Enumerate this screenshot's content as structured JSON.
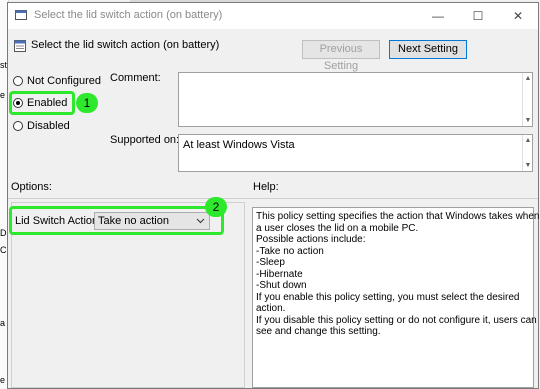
{
  "window": {
    "title": "Select the lid switch action (on battery)",
    "controls": {
      "minimize": "—",
      "maximize": "☐",
      "close": "✕"
    }
  },
  "header": {
    "policy_name": "Select the lid switch action (on battery)",
    "previous_label": "Previous Setting",
    "next_label": "Next Setting"
  },
  "state": {
    "options": [
      {
        "label": "Not Configured",
        "selected": false
      },
      {
        "label": "Enabled",
        "selected": true
      },
      {
        "label": "Disabled",
        "selected": false
      }
    ]
  },
  "comment": {
    "label": "Comment:",
    "value": ""
  },
  "supported": {
    "label": "Supported on:",
    "value": "At least Windows Vista"
  },
  "options_pane": {
    "label": "Options:",
    "field_label": "Lid Switch Action",
    "field_value": "Take no action"
  },
  "help": {
    "label": "Help:",
    "lines": [
      "This policy setting specifies the action that Windows takes when",
      "a user closes the lid on a mobile PC.",
      "",
      "Possible actions include:",
      "-Take no action",
      "-Sleep",
      "-Hibernate",
      "-Shut down",
      "",
      "If you enable this policy setting, you must select the desired",
      "action.",
      "",
      "If you disable this policy setting or do not configure it, users can",
      "see and change this setting."
    ]
  },
  "annotations": [
    {
      "label": "1"
    },
    {
      "label": "2"
    }
  ],
  "background_fragments": [
    "st",
    "e",
    "D",
    "C",
    "a",
    "e"
  ],
  "colors": {
    "highlight": "#2ee82e",
    "accent": "#0078d7"
  },
  "icons": {
    "title": "policy-icon",
    "header": "policy-setting-icon"
  }
}
